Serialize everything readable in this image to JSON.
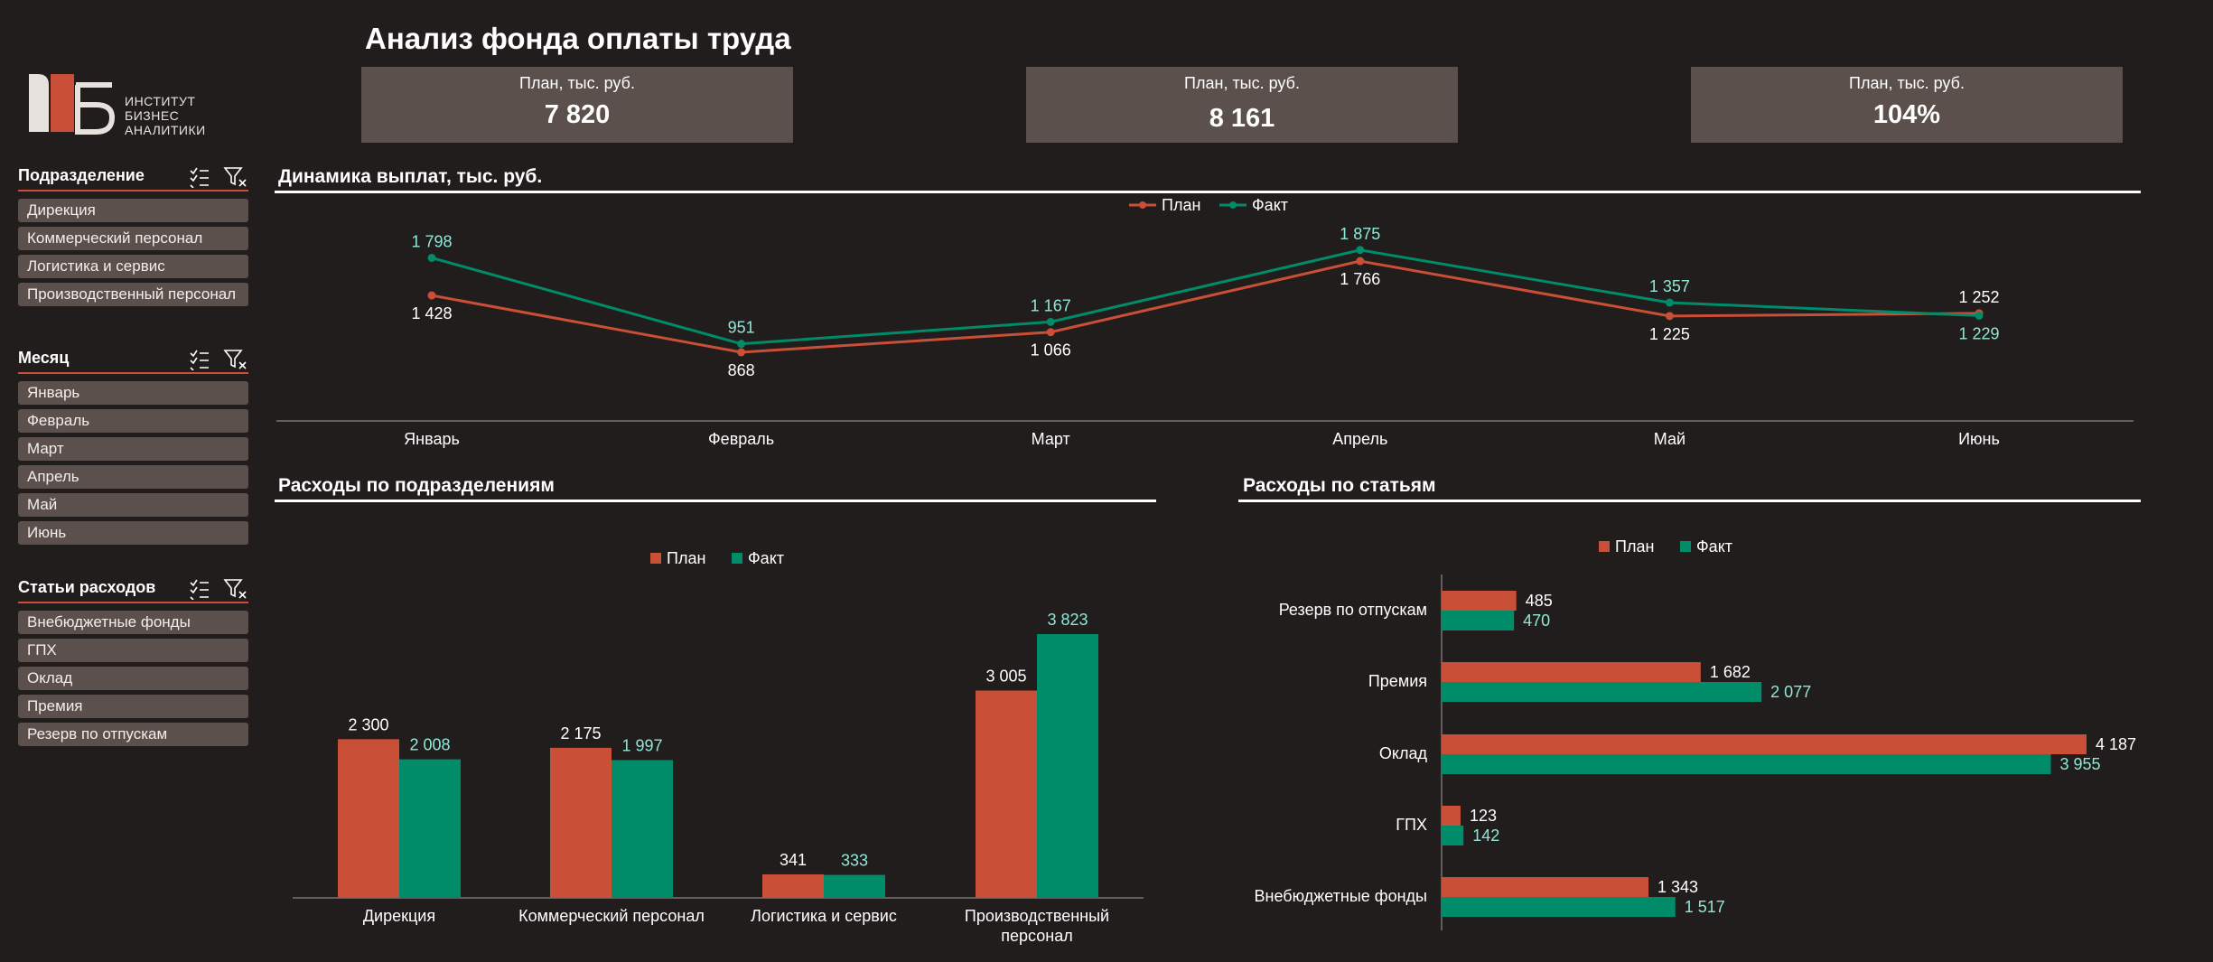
{
  "page": {
    "title": "Анализ фонда оплаты труда"
  },
  "logo": {
    "mark": "ИБА",
    "lines": [
      "ИНСТИТУТ",
      "БИЗНЕС",
      "АНАЛИТИКИ"
    ]
  },
  "kpis": [
    {
      "label": "План, тыс. руб.",
      "value": "7 820"
    },
    {
      "label": "План, тыс. руб.",
      "value": "8 161"
    },
    {
      "label": "План, тыс. руб.",
      "value": "104%"
    }
  ],
  "slicers": [
    {
      "title": "Подразделение",
      "items": [
        "Дирекция",
        "Коммерческий персонал",
        "Логистика и сервис",
        "Производственный персонал"
      ]
    },
    {
      "title": "Месяц",
      "items": [
        "Январь",
        "Февраль",
        "Март",
        "Апрель",
        "Май",
        "Июнь"
      ]
    },
    {
      "title": "Статьи расходов",
      "items": [
        "Внебюджетные фонды",
        "ГПХ",
        "Оклад",
        "Премия",
        "Резерв по отпускам"
      ]
    }
  ],
  "icons": {
    "select_all": "checklist-icon",
    "clear_filter": "filter-clear-icon"
  },
  "colors": {
    "plan": "#c94f36",
    "fact": "#008c69",
    "fact_label": "#8ee8d8",
    "card": "#5c504d",
    "background": "#211d1c"
  },
  "chart_data": [
    {
      "id": "line",
      "type": "line",
      "title": "Динамика выплат, тыс. руб.",
      "categories": [
        "Январь",
        "Февраль",
        "Март",
        "Апрель",
        "Май",
        "Июнь"
      ],
      "series": [
        {
          "name": "План",
          "values": [
            1428,
            868,
            1066,
            1766,
            1225,
            1252
          ]
        },
        {
          "name": "Факт",
          "values": [
            1798,
            951,
            1167,
            1875,
            1357,
            1229
          ]
        }
      ],
      "labels": {
        "План": [
          "1 428",
          "868",
          "1 066",
          "1 766",
          "1 225",
          "1 252"
        ],
        "Факт": [
          "1 798",
          "951",
          "1 167",
          "1 875",
          "1 357",
          "1 229"
        ]
      },
      "legend": "top-center",
      "grid": false
    },
    {
      "id": "dept",
      "type": "bar",
      "title": "Расходы по подразделениям",
      "categories": [
        "Дирекция",
        "Коммерческий персонал",
        "Логистика и сервис",
        "Производственный персонал"
      ],
      "category_lines": [
        [
          "Дирекция"
        ],
        [
          "Коммерческий персонал"
        ],
        [
          "Логистика и сервис"
        ],
        [
          "Производственный",
          "персонал"
        ]
      ],
      "series": [
        {
          "name": "План",
          "values": [
            2300,
            2175,
            341,
            3005
          ]
        },
        {
          "name": "Факт",
          "values": [
            2008,
            1997,
            333,
            3823
          ]
        }
      ],
      "labels": {
        "План": [
          "2 300",
          "2 175",
          "341",
          "3 005"
        ],
        "Факт": [
          "2 008",
          "1 997",
          "333",
          "3 823"
        ]
      },
      "legend": "top-center",
      "grid": false
    },
    {
      "id": "items",
      "type": "bar",
      "orientation": "horizontal",
      "title": "Расходы по статьям",
      "categories": [
        "Резерв по отпускам",
        "Премия",
        "Оклад",
        "ГПХ",
        "Внебюджетные фонды"
      ],
      "series": [
        {
          "name": "План",
          "values": [
            485,
            1682,
            4187,
            123,
            1343
          ]
        },
        {
          "name": "Факт",
          "values": [
            470,
            2077,
            3955,
            142,
            1517
          ]
        }
      ],
      "labels": {
        "План": [
          "485",
          "1 682",
          "4 187",
          "123",
          "1 343"
        ],
        "Факт": [
          "470",
          "2 077",
          "3 955",
          "142",
          "1 517"
        ]
      },
      "legend": "top-center",
      "grid": false
    }
  ]
}
